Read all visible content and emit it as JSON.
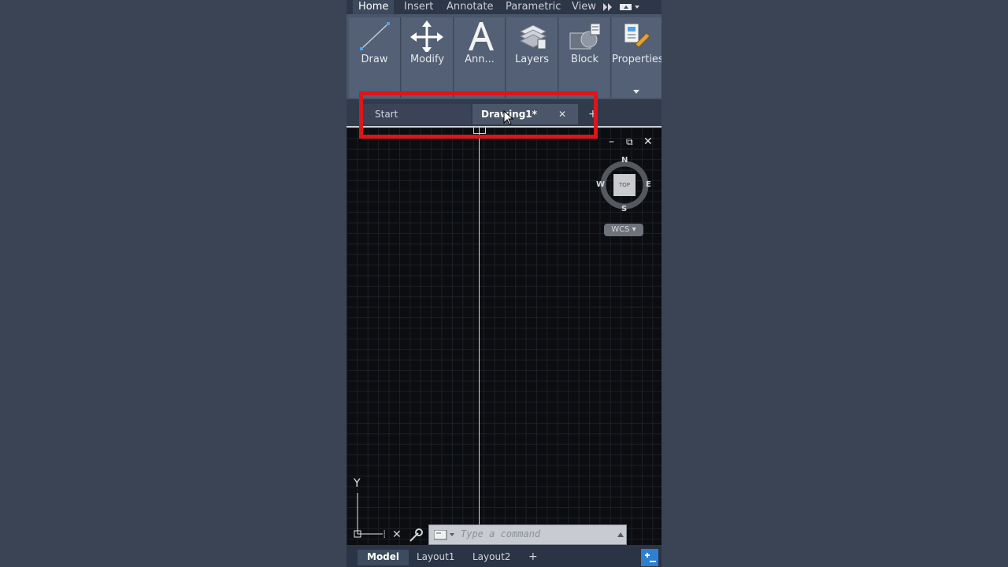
{
  "ribbon_tabs": [
    "Home",
    "Insert",
    "Annotate",
    "Parametric",
    "View"
  ],
  "ribbon_buttons": [
    {
      "label": "Draw",
      "icon": "line-icon"
    },
    {
      "label": "Modify",
      "icon": "move-icon"
    },
    {
      "label": "Ann...",
      "icon": "text-a-icon"
    },
    {
      "label": "Layers",
      "icon": "layers-icon"
    },
    {
      "label": "Block",
      "icon": "block-icon"
    },
    {
      "label": "Properties",
      "icon": "properties-icon"
    }
  ],
  "file_tabs": {
    "start": "Start",
    "drawing": "Drawing1*",
    "close_glyph": "✕",
    "add_glyph": "+"
  },
  "viewcube": {
    "face": "TOP",
    "north": "N",
    "south": "S",
    "east": "E",
    "west": "W",
    "wcs": "WCS"
  },
  "ucs": {
    "y_label": "Y"
  },
  "command": {
    "placeholder": "Type a command"
  },
  "layout_tabs": [
    "Model",
    "Layout1",
    "Layout2"
  ],
  "layout_add": "+",
  "colors": {
    "highlight_box": "#e0141b",
    "canvas": "#0c0d10",
    "ribbon": "#4a5669"
  }
}
